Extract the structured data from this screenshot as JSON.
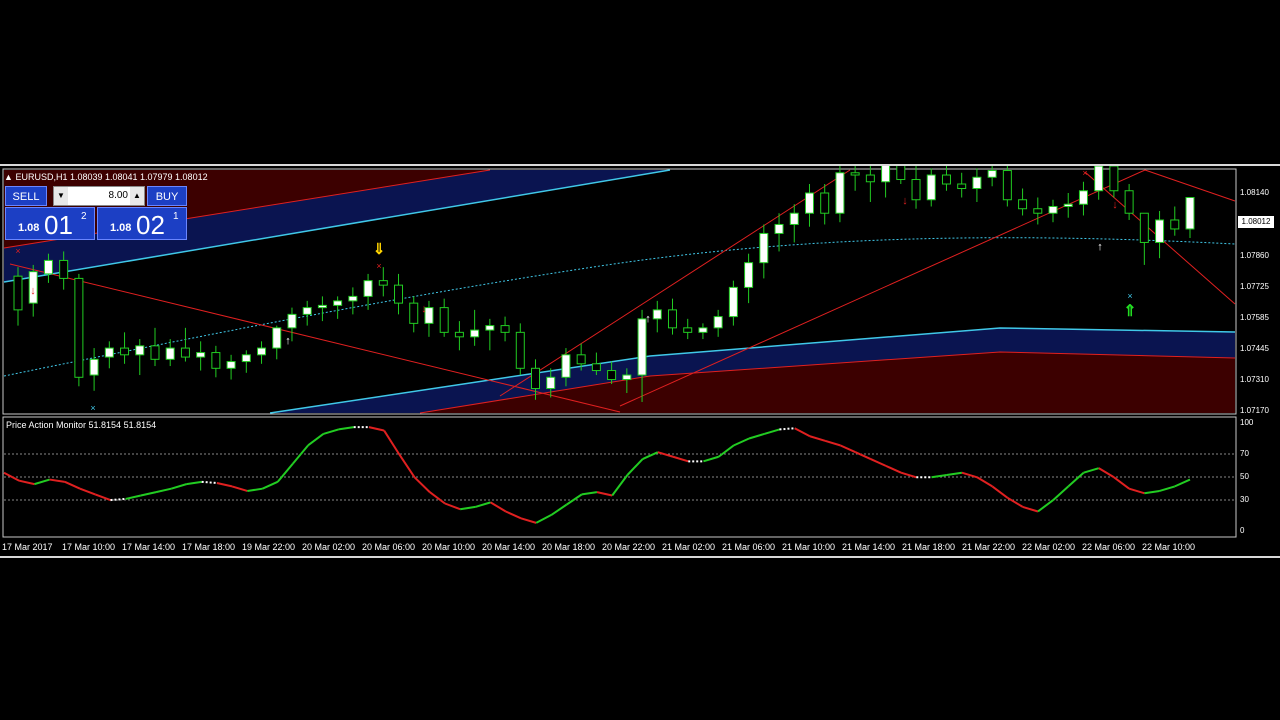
{
  "chart": {
    "symbol_info": "EURUSD,H1  1.08039 1.08041 1.07979 1.08012",
    "current_price": "1.08012",
    "price_axis": [
      "1.08140",
      "1.07860",
      "1.07725",
      "1.07585",
      "1.07445",
      "1.07310",
      "1.07170"
    ],
    "indicator_label": "Price Action Monitor 51.8154 51.8154",
    "indicator_axis": [
      "100",
      "70",
      "50",
      "30",
      "0"
    ],
    "time_axis": [
      "17 Mar 2017",
      "17 Mar 10:00",
      "17 Mar 14:00",
      "17 Mar 18:00",
      "19 Mar 22:00",
      "20 Mar 02:00",
      "20 Mar 06:00",
      "20 Mar 10:00",
      "20 Mar 14:00",
      "20 Mar 18:00",
      "20 Mar 22:00",
      "21 Mar 02:00",
      "21 Mar 06:00",
      "21 Mar 10:00",
      "21 Mar 14:00",
      "21 Mar 18:00",
      "21 Mar 22:00",
      "22 Mar 02:00",
      "22 Mar 06:00",
      "22 Mar 10:00"
    ]
  },
  "trade_panel": {
    "sell_label": "SELL",
    "buy_label": "BUY",
    "lot_value": "8.00",
    "lot_down": "▼",
    "lot_up": "▲",
    "sell_price_small": "1.08",
    "sell_price_big": "01",
    "sell_price_sup": "2",
    "buy_price_small": "1.08",
    "buy_price_big": "02",
    "buy_price_sup": "1"
  },
  "colors": {
    "bull_candle": "#ffffff",
    "candle_wick": "#22cc22",
    "band_red": "#4a0000",
    "band_blue": "#0a1450",
    "channel_cyan": "#40c8e8",
    "trend_red": "#e02020",
    "osc_green": "#22cc22",
    "osc_red": "#e02020"
  },
  "candles": [
    [
      1.0777,
      1.0781,
      1.0755,
      1.0762
    ],
    [
      1.0765,
      1.0782,
      1.0759,
      1.0779
    ],
    [
      1.0778,
      1.0787,
      1.0774,
      1.0784
    ],
    [
      1.0784,
      1.0788,
      1.0771,
      1.0776
    ],
    [
      1.0776,
      1.0778,
      1.0728,
      1.0732
    ],
    [
      1.0733,
      1.0745,
      1.0726,
      1.074
    ],
    [
      1.0741,
      1.0748,
      1.0736,
      1.0745
    ],
    [
      1.0745,
      1.0752,
      1.0738,
      1.0742
    ],
    [
      1.0742,
      1.0749,
      1.0733,
      1.0746
    ],
    [
      1.0746,
      1.0754,
      1.0737,
      1.074
    ],
    [
      1.074,
      1.0749,
      1.0737,
      1.0745
    ],
    [
      1.0745,
      1.0754,
      1.0739,
      1.0741
    ],
    [
      1.0741,
      1.0748,
      1.0735,
      1.0743
    ],
    [
      1.0743,
      1.0746,
      1.0732,
      1.0736
    ],
    [
      1.0736,
      1.0742,
      1.0731,
      1.0739
    ],
    [
      1.0739,
      1.0744,
      1.0734,
      1.0742
    ],
    [
      1.0742,
      1.0748,
      1.0738,
      1.0745
    ],
    [
      1.0745,
      1.0755,
      1.074,
      1.0754
    ],
    [
      1.0754,
      1.0763,
      1.0748,
      1.076
    ],
    [
      1.076,
      1.0766,
      1.0755,
      1.0763
    ],
    [
      1.0763,
      1.0768,
      1.0757,
      1.0764
    ],
    [
      1.0764,
      1.0768,
      1.0758,
      1.0766
    ],
    [
      1.0766,
      1.0772,
      1.076,
      1.0768
    ],
    [
      1.0768,
      1.0778,
      1.0762,
      1.0775
    ],
    [
      1.0775,
      1.0781,
      1.0768,
      1.0773
    ],
    [
      1.0773,
      1.0778,
      1.076,
      1.0765
    ],
    [
      1.0765,
      1.0768,
      1.0752,
      1.0756
    ],
    [
      1.0756,
      1.0766,
      1.075,
      1.0763
    ],
    [
      1.0763,
      1.0767,
      1.075,
      1.0752
    ],
    [
      1.0752,
      1.0757,
      1.0744,
      1.075
    ],
    [
      1.075,
      1.0762,
      1.0746,
      1.0753
    ],
    [
      1.0753,
      1.0758,
      1.0744,
      1.0755
    ],
    [
      1.0755,
      1.0759,
      1.0748,
      1.0752
    ],
    [
      1.0752,
      1.0756,
      1.0733,
      1.0736
    ],
    [
      1.0736,
      1.074,
      1.0722,
      1.0727
    ],
    [
      1.0727,
      1.0736,
      1.0723,
      1.0732
    ],
    [
      1.0732,
      1.0745,
      1.0728,
      1.0742
    ],
    [
      1.0742,
      1.0747,
      1.0735,
      1.0738
    ],
    [
      1.0738,
      1.0743,
      1.0733,
      1.0735
    ],
    [
      1.0735,
      1.0739,
      1.0729,
      1.0731
    ],
    [
      1.0731,
      1.0736,
      1.0725,
      1.0733
    ],
    [
      1.0733,
      1.0762,
      1.0721,
      1.0758
    ],
    [
      1.0758,
      1.0766,
      1.0752,
      1.0762
    ],
    [
      1.0762,
      1.0767,
      1.0751,
      1.0754
    ],
    [
      1.0754,
      1.0758,
      1.0749,
      1.0752
    ],
    [
      1.0752,
      1.0756,
      1.0749,
      1.0754
    ],
    [
      1.0754,
      1.0762,
      1.075,
      1.0759
    ],
    [
      1.0759,
      1.0775,
      1.0755,
      1.0772
    ],
    [
      1.0772,
      1.0787,
      1.0765,
      1.0783
    ],
    [
      1.0783,
      1.08,
      1.0776,
      1.0796
    ],
    [
      1.0796,
      1.0805,
      1.0788,
      1.08
    ],
    [
      1.08,
      1.0809,
      1.0792,
      1.0805
    ],
    [
      1.0805,
      1.0818,
      1.0799,
      1.0814
    ],
    [
      1.0814,
      1.0818,
      1.08,
      1.0805
    ],
    [
      1.0805,
      1.0826,
      1.0801,
      1.0823
    ],
    [
      1.0823,
      1.0828,
      1.0815,
      1.0822
    ],
    [
      1.0822,
      1.083,
      1.081,
      1.0819
    ],
    [
      1.0819,
      1.0828,
      1.0812,
      1.0827
    ],
    [
      1.0827,
      1.0829,
      1.0818,
      1.082
    ],
    [
      1.082,
      1.0826,
      1.0807,
      1.0811
    ],
    [
      1.0811,
      1.0825,
      1.0808,
      1.0822
    ],
    [
      1.0822,
      1.0827,
      1.0815,
      1.0818
    ],
    [
      1.0818,
      1.0823,
      1.0812,
      1.0816
    ],
    [
      1.0816,
      1.0825,
      1.081,
      1.0821
    ],
    [
      1.0821,
      1.0828,
      1.0817,
      1.0824
    ],
    [
      1.0824,
      1.0828,
      1.0808,
      1.0811
    ],
    [
      1.0811,
      1.0816,
      1.0804,
      1.0807
    ],
    [
      1.0807,
      1.0812,
      1.08,
      1.0805
    ],
    [
      1.0805,
      1.0811,
      1.0801,
      1.0808
    ],
    [
      1.0808,
      1.0814,
      1.0803,
      1.0809
    ],
    [
      1.0809,
      1.0819,
      1.0804,
      1.0815
    ],
    [
      1.0815,
      1.083,
      1.0811,
      1.0826
    ],
    [
      1.0826,
      1.0829,
      1.0812,
      1.0815
    ],
    [
      1.0815,
      1.0818,
      1.0802,
      1.0805
    ],
    [
      1.0805,
      1.0803,
      1.0782,
      1.0792
    ],
    [
      1.0792,
      1.0806,
      1.0785,
      1.0802
    ],
    [
      1.0802,
      1.0808,
      1.0795,
      1.0798
    ],
    [
      1.0798,
      1.0812,
      1.0794,
      1.0812
    ]
  ],
  "oscillator": [
    52,
    45,
    42,
    46,
    44,
    38,
    33,
    28,
    29,
    32,
    35,
    38,
    42,
    44,
    43,
    40,
    36,
    38,
    44,
    60,
    76,
    86,
    90,
    92,
    92,
    89,
    68,
    48,
    35,
    25,
    20,
    22,
    26,
    18,
    12,
    8,
    15,
    24,
    33,
    35,
    32,
    50,
    64,
    70,
    66,
    62,
    62,
    66,
    76,
    82,
    86,
    90,
    91,
    84,
    80,
    76,
    70,
    64,
    58,
    52,
    48,
    48,
    50,
    52,
    48,
    40,
    30,
    22,
    18,
    28,
    40,
    52,
    56,
    48,
    38,
    34,
    36,
    40,
    46
  ]
}
